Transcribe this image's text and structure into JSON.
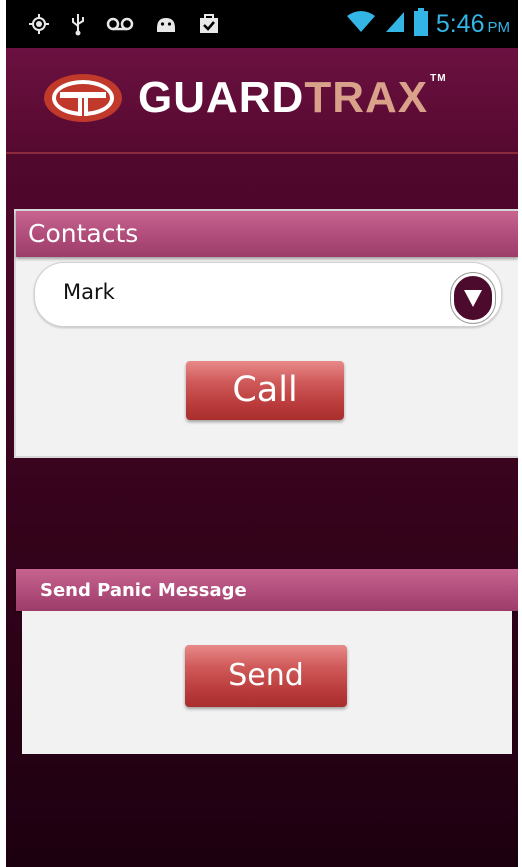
{
  "status_bar": {
    "icons": [
      "gps-icon",
      "usb-icon",
      "voicemail-icon",
      "android-icon",
      "task-icon",
      "wifi-icon",
      "signal-icon",
      "battery-icon"
    ],
    "time": "5:46",
    "ampm": "PM"
  },
  "app": {
    "logo_text_1": "GUARD",
    "logo_text_2": "TRAX",
    "logo_tm": "TM"
  },
  "contacts": {
    "title": "Contacts",
    "selected": "Mark",
    "call_label": "Call"
  },
  "panic": {
    "title": "Send Panic Message",
    "send_label": "Send"
  },
  "colors": {
    "background": "#4a0628",
    "panel_header": "#b04c7a",
    "button": "#c44444",
    "clock": "#33b5e5"
  }
}
